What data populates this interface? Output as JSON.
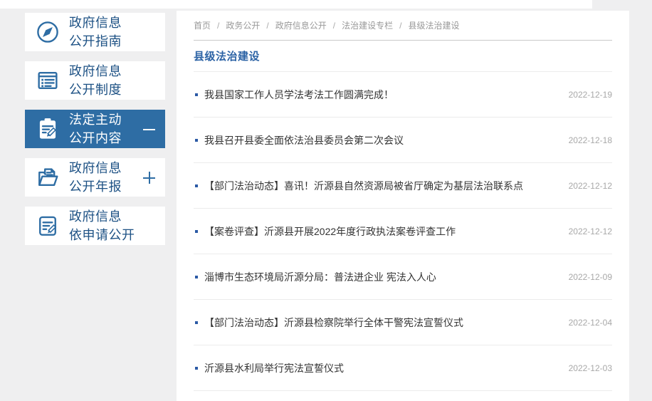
{
  "colors": {
    "accent": "#2e6da4",
    "sidebar_text": "#1d5184",
    "title": "#2c63a5",
    "article_text": "#333333",
    "muted": "#999999",
    "background": "#efeff0",
    "bullet": "#2b5aa5"
  },
  "sidebar": {
    "items": [
      {
        "label_line1": "政府信息",
        "label_line2": "公开指南",
        "icon": "compass-icon",
        "active": false,
        "toggle": "none"
      },
      {
        "label_line1": "政府信息",
        "label_line2": "公开制度",
        "icon": "list-document-icon",
        "active": false,
        "toggle": "none"
      },
      {
        "label_line1": "法定主动",
        "label_line2": "公开内容",
        "icon": "clipboard-pen-icon",
        "active": true,
        "toggle": "collapse"
      },
      {
        "label_line1": "政府信息",
        "label_line2": "公开年报",
        "icon": "folder-document-icon",
        "active": false,
        "toggle": "expand"
      },
      {
        "label_line1": "政府信息",
        "label_line2": "依申请公开",
        "icon": "document-pen-icon",
        "active": false,
        "toggle": "none"
      }
    ]
  },
  "breadcrumb": {
    "separator": "/",
    "items": [
      "首页",
      "政务公开",
      "政府信息公开",
      "法治建设专栏",
      "县级法治建设"
    ]
  },
  "main": {
    "title": "县级法治建设",
    "articles": [
      {
        "title": "我县国家工作人员学法考法工作圆满完成！",
        "date": "2022-12-19"
      },
      {
        "title": "我县召开县委全面依法治县委员会第二次会议",
        "date": "2022-12-18"
      },
      {
        "title": "【部门法治动态】喜讯！沂源县自然资源局被省厅确定为基层法治联系点",
        "date": "2022-12-12"
      },
      {
        "title": "【案卷评查】沂源县开展2022年度行政执法案卷评查工作",
        "date": "2022-12-12"
      },
      {
        "title": "淄博市生态环境局沂源分局：普法进企业 宪法入人心",
        "date": "2022-12-09"
      },
      {
        "title": "【部门法治动态】沂源县检察院举行全体干警宪法宣誓仪式",
        "date": "2022-12-04"
      },
      {
        "title": "沂源县水利局举行宪法宣誓仪式",
        "date": "2022-12-03"
      }
    ]
  }
}
